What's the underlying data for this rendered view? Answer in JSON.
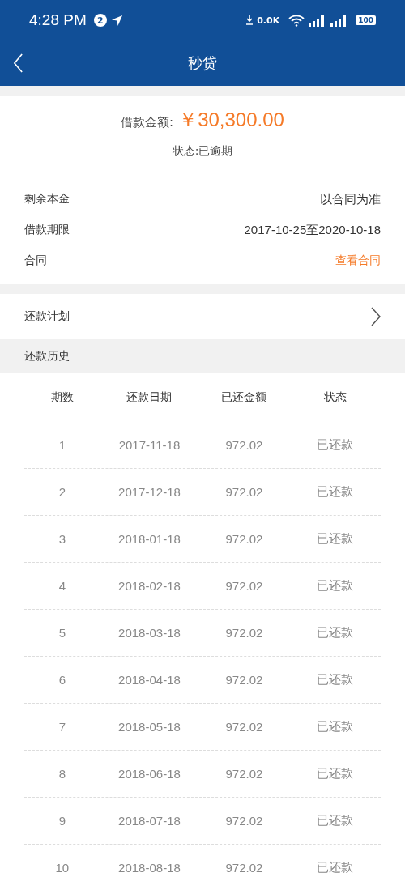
{
  "status_bar": {
    "time": "4:28 PM",
    "notification_count": "2",
    "net_speed": "0.0K",
    "battery": "100"
  },
  "nav_bar": {
    "title": "秒贷"
  },
  "summary": {
    "amount_label": "借款金额:",
    "amount": "￥30,300.00",
    "status": "状态:已逾期"
  },
  "details": [
    {
      "label": "剩余本金",
      "value": "以合同为准",
      "kind": "text"
    },
    {
      "label": "借款期限",
      "value": "2017-10-25至2020-10-18",
      "kind": "text"
    },
    {
      "label": "合同",
      "value": "查看合同",
      "kind": "link"
    }
  ],
  "plan_row": {
    "label": "还款计划"
  },
  "history": {
    "title": "还款历史",
    "columns": [
      "期数",
      "还款日期",
      "已还金额",
      "状态"
    ],
    "rows": [
      [
        "1",
        "2017-11-18",
        "972.02",
        "已还款"
      ],
      [
        "2",
        "2017-12-18",
        "972.02",
        "已还款"
      ],
      [
        "3",
        "2018-01-18",
        "972.02",
        "已还款"
      ],
      [
        "4",
        "2018-02-18",
        "972.02",
        "已还款"
      ],
      [
        "5",
        "2018-03-18",
        "972.02",
        "已还款"
      ],
      [
        "6",
        "2018-04-18",
        "972.02",
        "已还款"
      ],
      [
        "7",
        "2018-05-18",
        "972.02",
        "已还款"
      ],
      [
        "8",
        "2018-06-18",
        "972.02",
        "已还款"
      ],
      [
        "9",
        "2018-07-18",
        "972.02",
        "已还款"
      ],
      [
        "10",
        "2018-08-18",
        "972.02",
        "已还款"
      ]
    ]
  }
}
